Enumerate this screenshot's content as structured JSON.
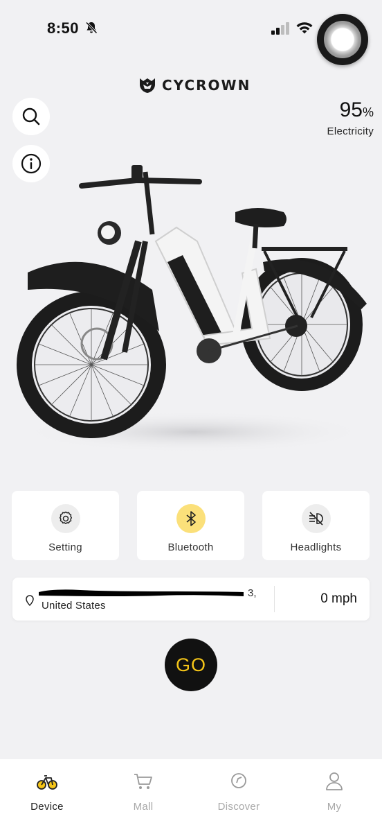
{
  "status_bar": {
    "time": "8:50",
    "icons": [
      "bell-slash-icon",
      "cellular-signal-icon",
      "wifi-icon"
    ]
  },
  "brand": {
    "name": "CYCROWN",
    "logo_icon": "cycrown-helmet-logo"
  },
  "tools": {
    "search_icon": "search-icon",
    "info_icon": "info-icon"
  },
  "battery": {
    "value": "95",
    "unit": "%",
    "label": "Electricity",
    "level": 0.95
  },
  "features": [
    {
      "label": "Setting",
      "icon": "gear-icon",
      "active": false
    },
    {
      "label": "Bluetooth",
      "icon": "bluetooth-icon",
      "active": true
    },
    {
      "label": "Headlights",
      "icon": "headlight-off-icon",
      "active": false
    }
  ],
  "location": {
    "address_suffix": "3,",
    "country": "United States",
    "speed": "0 mph"
  },
  "go_button": {
    "label": "GO"
  },
  "tabs": [
    {
      "label": "Device",
      "icon": "bicycle-icon",
      "active": true
    },
    {
      "label": "Mall",
      "icon": "cart-icon",
      "active": false
    },
    {
      "label": "Discover",
      "icon": "compass-icon",
      "active": false
    },
    {
      "label": "My",
      "icon": "person-icon",
      "active": false
    }
  ],
  "colors": {
    "background": "#f1f1f3",
    "accent_yellow": "#f5c518",
    "bluetooth_active_bg": "#fbe07a",
    "card_bg": "#ffffff",
    "go_bg": "#111111"
  }
}
